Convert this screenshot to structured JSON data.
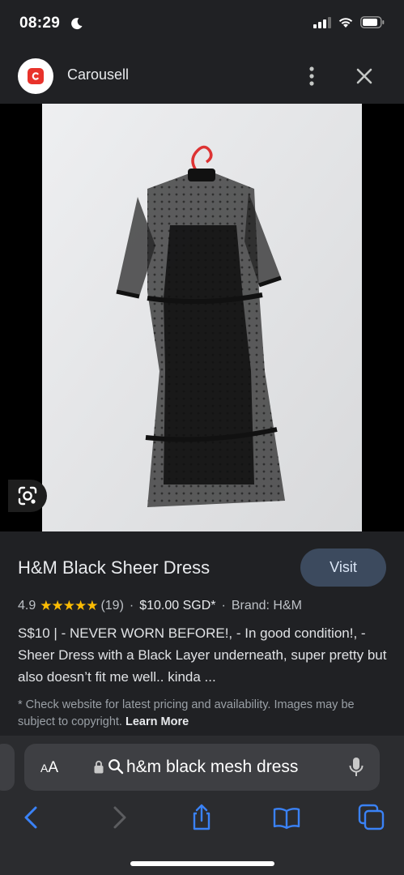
{
  "status_bar": {
    "time": "08:29",
    "icons": [
      "moon-icon",
      "signal-icon",
      "wifi-icon",
      "battery-icon"
    ]
  },
  "header": {
    "site_name": "Carousell",
    "logo_icon": "carousell-logo",
    "menu_icon": "more-vert-icon",
    "close_icon": "close-icon"
  },
  "image": {
    "lens_icon": "google-lens-icon"
  },
  "product": {
    "title": "H&M Black Sheer Dress",
    "visit_label": "Visit",
    "rating": "4.9",
    "stars": "★★★★★",
    "review_count": "(19)",
    "price": "$10.00 SGD*",
    "brand": "Brand: H&M",
    "description": "S$10 | - NEVER WORN BEFORE!, - In good condition!, - Sheer Dress with a Black Layer underneath, super pretty but also doesn’t fit me well.. kinda ...",
    "notice": "* Check website for pricing and availability. Images may be subject to copyright.",
    "notice_full": "* Check website for latest pricing and availability. Images may be subject to copyright.",
    "learn_more": "Learn More"
  },
  "browser": {
    "text_size_small": "A",
    "text_size_big": "A",
    "query": "h&m black mesh dress",
    "icons": [
      "lock-icon",
      "search-icon",
      "mic-icon",
      "back-icon",
      "forward-icon",
      "share-icon",
      "bookmarks-icon",
      "tabs-icon"
    ]
  },
  "colors": {
    "background": "#202124",
    "accent_star": "#fbbc04",
    "visit_button": "#3c4a5e",
    "ios_blue": "#3a82f7",
    "carousell_red": "#e8322b"
  }
}
